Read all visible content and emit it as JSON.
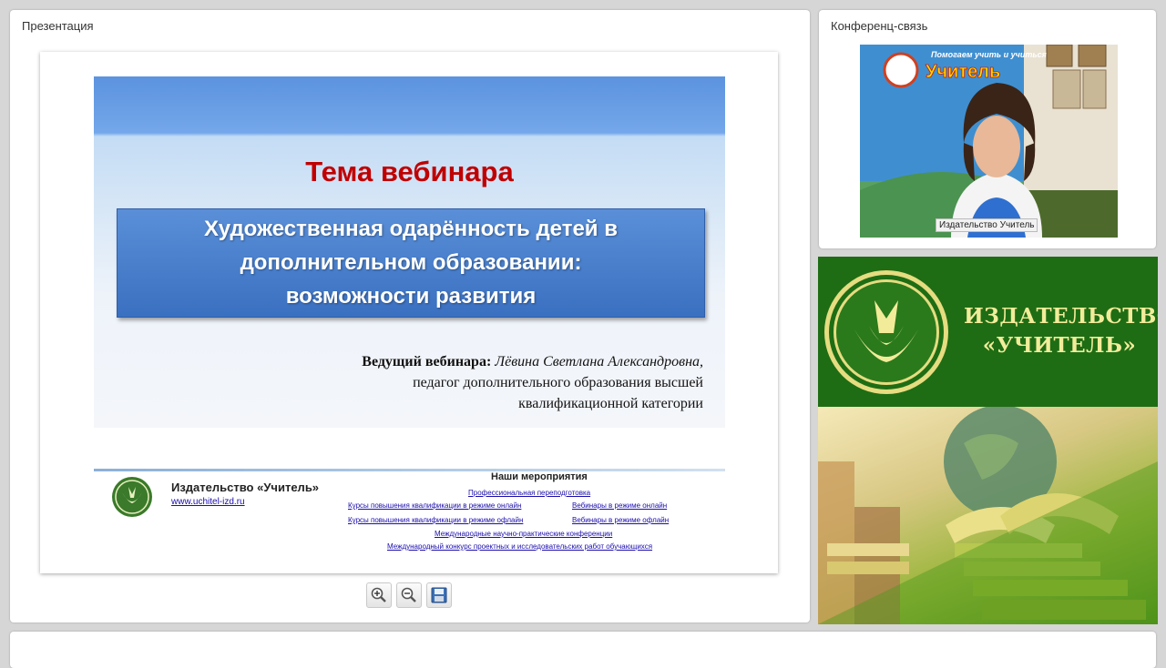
{
  "presentation_panel": {
    "title": "Презентация"
  },
  "slide": {
    "heading": "Тема вебинара",
    "topic_lines": [
      "Художественная одарённость  детей в",
      "дополнительном образовании:",
      "возможности развития"
    ],
    "presenter_label": "Ведущий вебинара:",
    "presenter_name": "Лёвина Светлана Александровна,",
    "presenter_role_line1": "педагог дополнительного образования высшей",
    "presenter_role_line2": "квалификационной категории",
    "footer": {
      "publisher": "Издательство «Учитель»",
      "url": "www.uchitel-izd.ru",
      "events_title": "Наши мероприятия",
      "events": {
        "retraining": "Профессиональная переподготовка",
        "courses_online": "Курсы повышения квалификации в режиме онлайн",
        "webinars_online": "Вебинары в режиме онлайн",
        "courses_offline": "Курсы повышения квалификации в режиме офлайн",
        "webinars_offline": "Вебинары в режиме офлайн",
        "conferences": "Международные научно-практические конференции",
        "contest": "Международный конкурс проектных и исследовательских работ обучающихся"
      }
    }
  },
  "toolbar": {
    "zoom_in_icon": "zoom-in-icon",
    "zoom_out_icon": "zoom-out-icon",
    "save_icon": "floppy-save-icon"
  },
  "conference_panel": {
    "title": "Конференц-связь",
    "camera_label": "Издательство Учитель",
    "backdrop_banner_top": "Помогаем учить и учиться",
    "backdrop_banner_logo": "Учитель"
  },
  "brand_banner": {
    "line1": "ИЗДАТЕЛЬСТВО",
    "line2": "«УЧИТЕЛЬ»"
  },
  "colors": {
    "brand_green": "#1e6d14",
    "brand_gold": "#f2ec9a",
    "slide_heading": "#c00000",
    "topic_box": "#4a80cc"
  }
}
